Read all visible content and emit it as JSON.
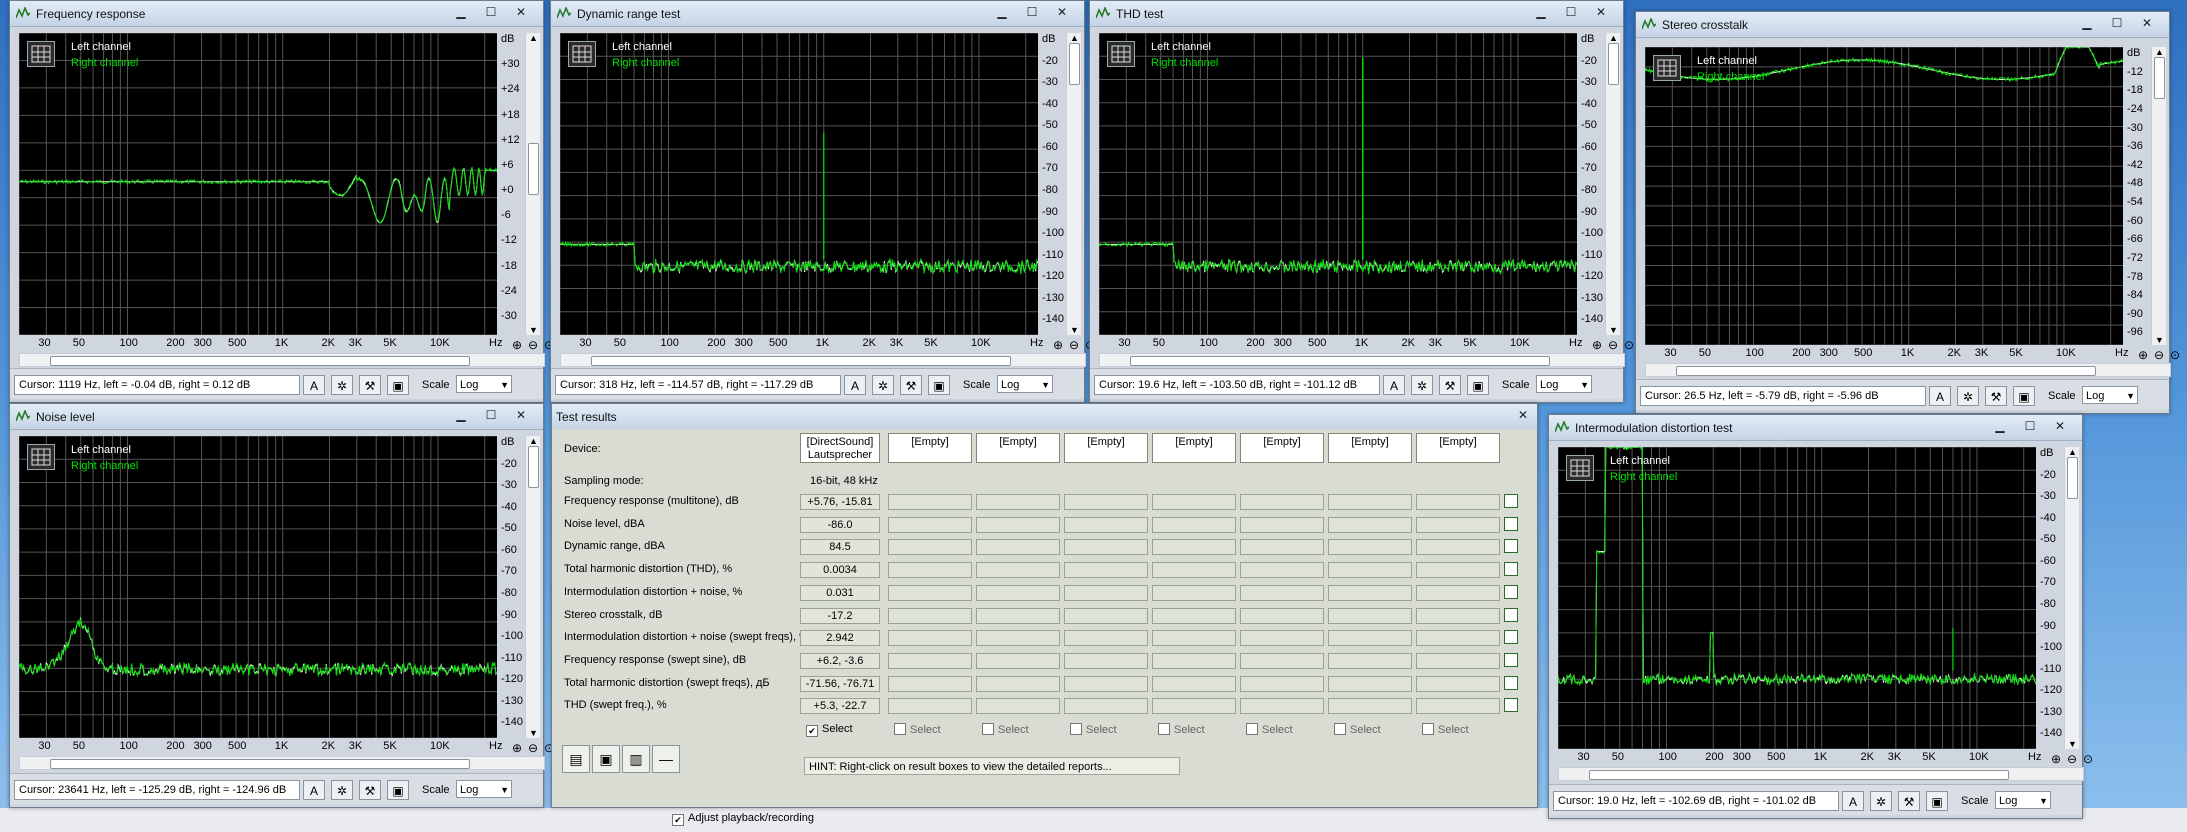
{
  "desktop": {
    "adjust_label": "Adjust playback/recording"
  },
  "windows": {
    "freq": {
      "title": "Frequency response",
      "legend_left": "Left channel",
      "legend_right": "Right channel",
      "unit": "dB",
      "y_labels": [
        "+30",
        "+24",
        "+18",
        "+12",
        "+6",
        "+0",
        "-6",
        "-12",
        "-18",
        "-24",
        "-30"
      ],
      "x_labels": [
        "30",
        "50",
        "100",
        "200",
        "300",
        "500",
        "1K",
        "2K",
        "3K",
        "5K",
        "10K",
        "Hz"
      ],
      "cursor": "Cursor:  1119 Hz,  left = -0.04 dB,  right = 0.12 dB",
      "scale_label": "Scale",
      "scale_value": "Log"
    },
    "dyn": {
      "title": "Dynamic range test",
      "legend_left": "Left channel",
      "legend_right": "Right channel",
      "unit": "dB",
      "y_labels": [
        "-20",
        "-30",
        "-40",
        "-50",
        "-60",
        "-70",
        "-80",
        "-90",
        "-100",
        "-110",
        "-120",
        "-130",
        "-140"
      ],
      "x_labels": [
        "30",
        "50",
        "100",
        "200",
        "300",
        "500",
        "1K",
        "2K",
        "3K",
        "5K",
        "10K",
        "Hz"
      ],
      "cursor": "Cursor:  318 Hz,  left = -114.57 dB,  right = -117.29 dB",
      "scale_label": "Scale",
      "scale_value": "Log"
    },
    "thd": {
      "title": "THD test",
      "legend_left": "Left channel",
      "legend_right": "Right channel",
      "unit": "dB",
      "y_labels": [
        "-20",
        "-30",
        "-40",
        "-50",
        "-60",
        "-70",
        "-80",
        "-90",
        "-100",
        "-110",
        "-120",
        "-130",
        "-140"
      ],
      "x_labels": [
        "30",
        "50",
        "100",
        "200",
        "300",
        "500",
        "1K",
        "2K",
        "3K",
        "5K",
        "10K",
        "Hz"
      ],
      "cursor": "Cursor:  19.6 Hz,  left = -103.50 dB,  right = -101.12 dB",
      "scale_label": "Scale",
      "scale_value": "Log"
    },
    "xtalk": {
      "title": "Stereo crosstalk",
      "legend_left": "Left channel",
      "legend_right": "Right channel",
      "unit": "dB",
      "y_labels": [
        "-12",
        "-18",
        "-24",
        "-30",
        "-36",
        "-42",
        "-48",
        "-54",
        "-60",
        "-66",
        "-72",
        "-78",
        "-84",
        "-90",
        "-96"
      ],
      "x_labels": [
        "30",
        "50",
        "100",
        "200",
        "300",
        "500",
        "1K",
        "2K",
        "3K",
        "5K",
        "10K",
        "Hz"
      ],
      "cursor": "Cursor:  26.5 Hz,  left = -5.79 dB,  right = -5.96 dB",
      "scale_label": "Scale",
      "scale_value": "Log"
    },
    "noise": {
      "title": "Noise level",
      "legend_left": "Left channel",
      "legend_right": "Right channel",
      "unit": "dB",
      "y_labels": [
        "-20",
        "-30",
        "-40",
        "-50",
        "-60",
        "-70",
        "-80",
        "-90",
        "-100",
        "-110",
        "-120",
        "-130",
        "-140"
      ],
      "x_labels": [
        "30",
        "50",
        "100",
        "200",
        "300",
        "500",
        "1K",
        "2K",
        "3K",
        "5K",
        "10K",
        "Hz"
      ],
      "cursor": "Cursor:  23641 Hz,  left = -125.29 dB,  right = -124.96 dB",
      "scale_label": "Scale",
      "scale_value": "Log"
    },
    "imd": {
      "title": "Intermodulation distortion test",
      "legend_left": "Left channel",
      "legend_right": "Right channel",
      "unit": "dB",
      "y_labels": [
        "-20",
        "-30",
        "-40",
        "-50",
        "-60",
        "-70",
        "-80",
        "-90",
        "-100",
        "-110",
        "-120",
        "-130",
        "-140"
      ],
      "x_labels": [
        "30",
        "50",
        "100",
        "200",
        "300",
        "500",
        "1K",
        "2K",
        "3K",
        "5K",
        "10K",
        "Hz"
      ],
      "cursor": "Cursor:  19.0 Hz,  left = -102.69 dB,  right = -101.02 dB",
      "scale_label": "Scale",
      "scale_value": "Log"
    }
  },
  "results": {
    "title": "Test results",
    "device_label": "Device:",
    "sampling_label": "Sampling mode:",
    "sampling_value": "16-bit, 48 kHz",
    "devices": [
      "[DirectSound] Lautsprecher",
      "[Empty]",
      "[Empty]",
      "[Empty]",
      "[Empty]",
      "[Empty]",
      "[Empty]",
      "[Empty]"
    ],
    "rows": [
      {
        "label": "Frequency response (multitone), dB",
        "value": "+5.76, -15.81"
      },
      {
        "label": "Noise level, dBA",
        "value": "-86.0"
      },
      {
        "label": "Dynamic range, dBA",
        "value": "84.5"
      },
      {
        "label": "Total harmonic distortion (THD), %",
        "value": "0.0034"
      },
      {
        "label": "Intermodulation distortion + noise, %",
        "value": "0.031"
      },
      {
        "label": "Stereo crosstalk, dB",
        "value": "-17.2"
      },
      {
        "label": "Intermodulation distortion + noise (swept freqs), %",
        "value": "2.942"
      },
      {
        "label": "Frequency response (swept sine), dB",
        "value": "+6.2, -3.6"
      },
      {
        "label": "Total harmonic distortion (swept freqs), дБ",
        "value": "-71.56, -76.71"
      },
      {
        "label": "THD (swept freq.), %",
        "value": "+5.3, -22.7"
      }
    ],
    "select_label": "Select",
    "hint": "HINT: Right-click on result boxes to view the detailed reports..."
  },
  "colors": {
    "left_channel": "#ffffff",
    "right_channel": "#00e000",
    "graph_bg": "#000000"
  }
}
